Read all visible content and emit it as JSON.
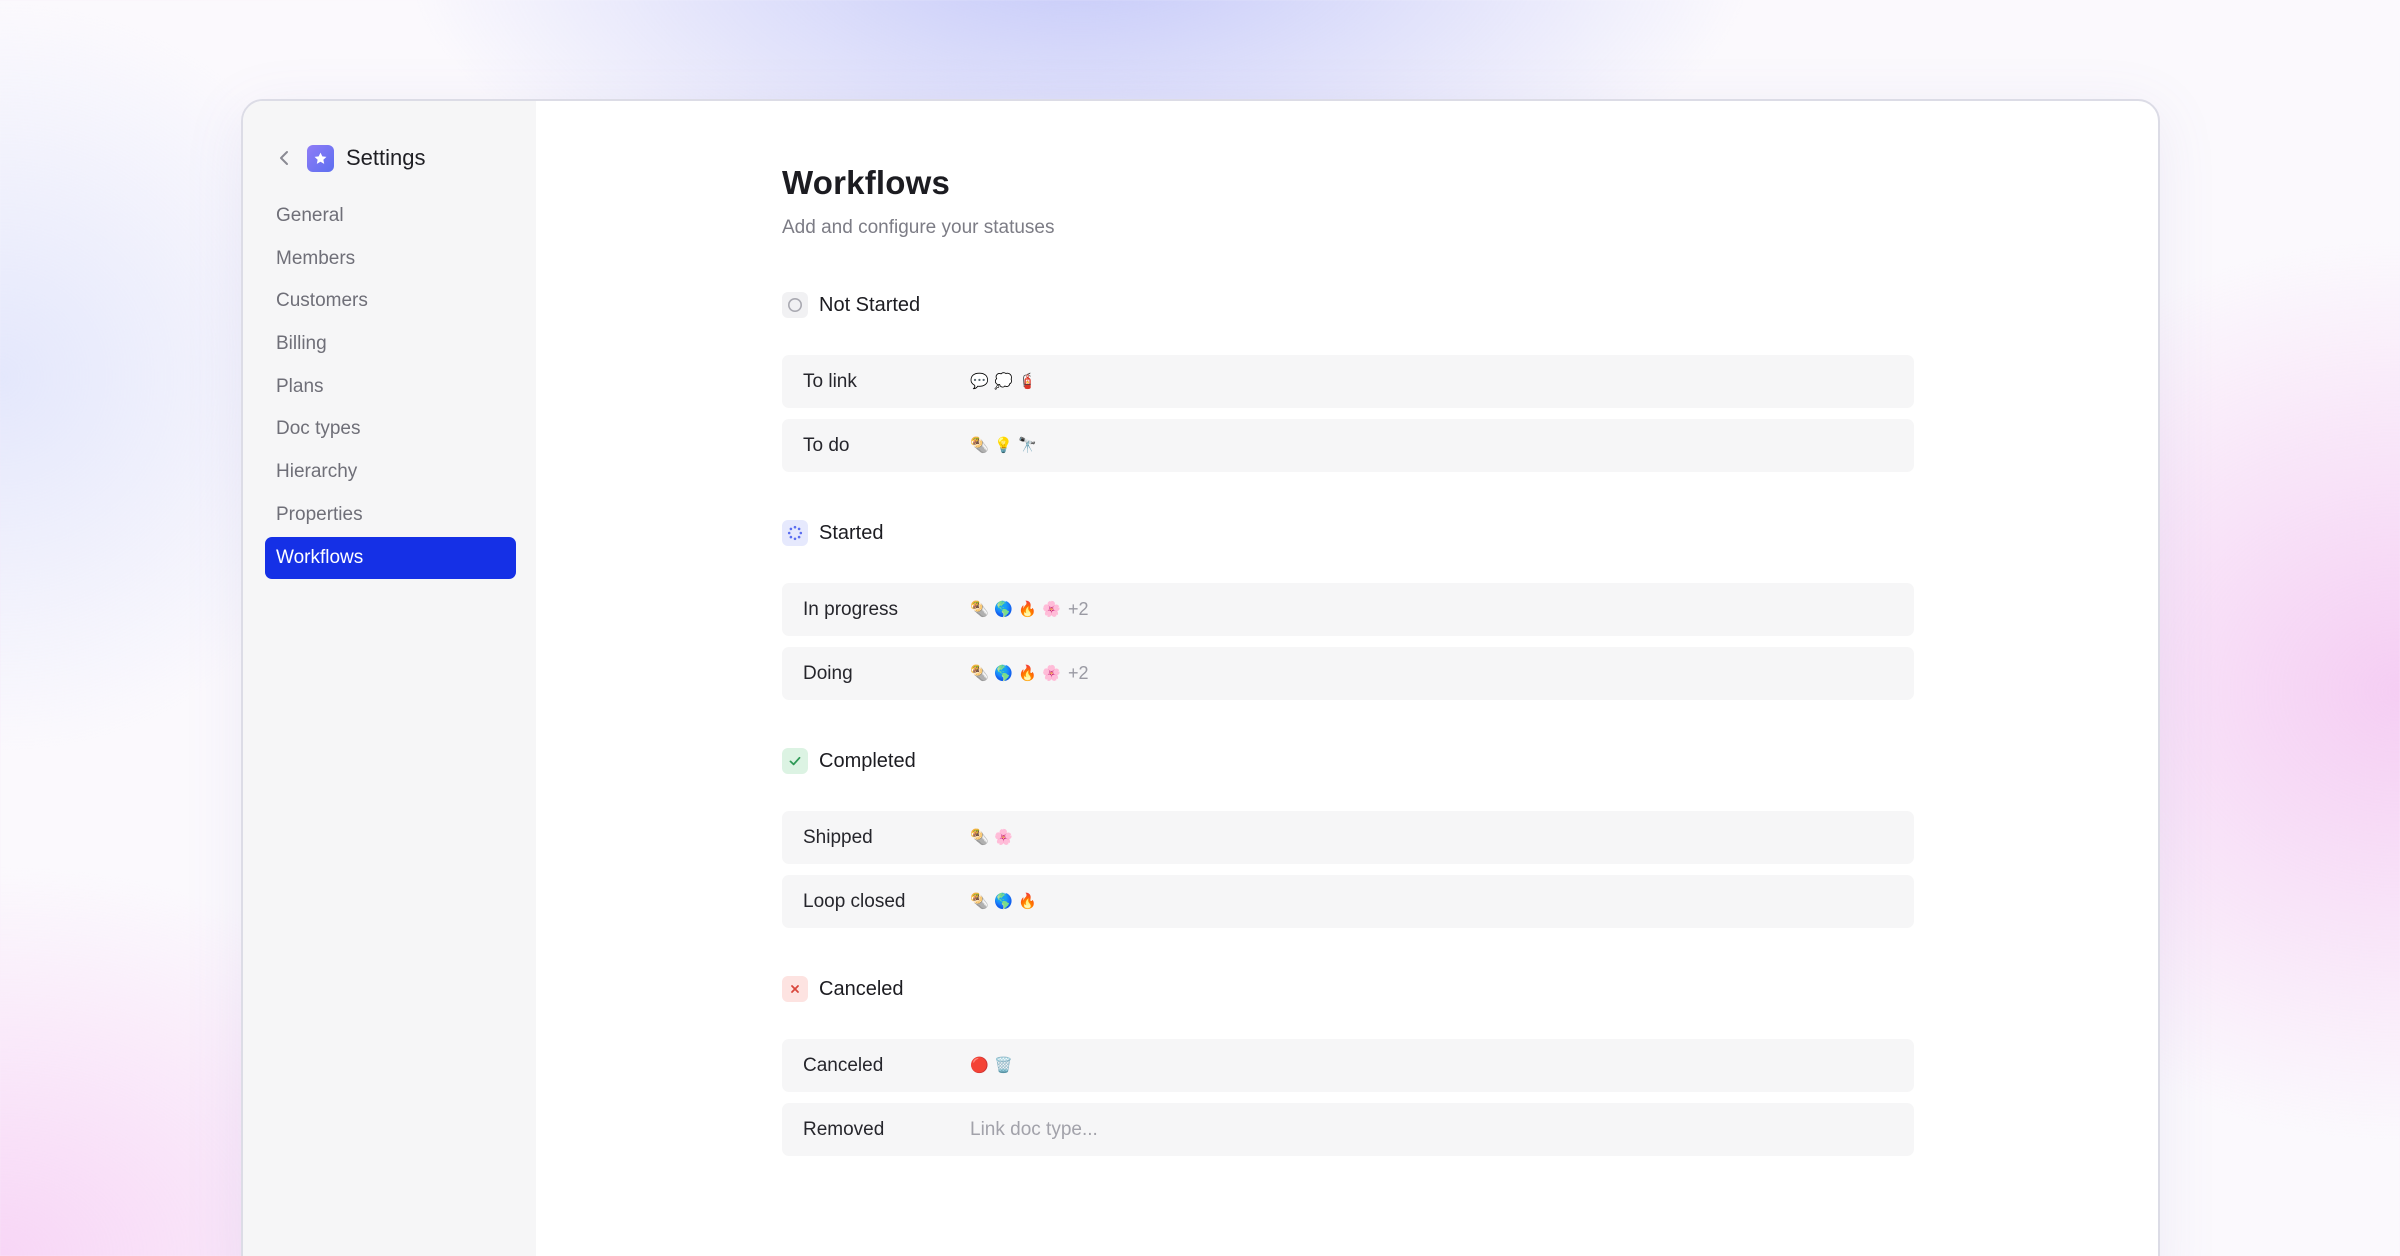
{
  "sidebar": {
    "title": "Settings",
    "back_icon": "chevron-left-icon",
    "logo_icon": "star-icon",
    "items": [
      {
        "label": "General",
        "active": false
      },
      {
        "label": "Members",
        "active": false
      },
      {
        "label": "Customers",
        "active": false
      },
      {
        "label": "Billing",
        "active": false
      },
      {
        "label": "Plans",
        "active": false
      },
      {
        "label": "Doc types",
        "active": false
      },
      {
        "label": "Hierarchy",
        "active": false
      },
      {
        "label": "Properties",
        "active": false
      },
      {
        "label": "Workflows",
        "active": true
      }
    ]
  },
  "main": {
    "title": "Workflows",
    "subtitle": "Add and configure your statuses",
    "groups": [
      {
        "label": "Not Started",
        "icon": "empty-circle-icon",
        "rows": [
          {
            "name": "To link",
            "emojis": [
              "💬",
              "💭",
              "🧯"
            ],
            "more": ""
          },
          {
            "name": "To do",
            "emojis": [
              "🌯",
              "💡",
              "🔭"
            ],
            "more": ""
          }
        ]
      },
      {
        "label": "Started",
        "icon": "progress-spinner-icon",
        "rows": [
          {
            "name": "In progress",
            "emojis": [
              "🌯",
              "🌎",
              "🔥",
              "🌸"
            ],
            "more": "+2"
          },
          {
            "name": "Doing",
            "emojis": [
              "🌯",
              "🌎",
              "🔥",
              "🌸"
            ],
            "more": "+2"
          }
        ]
      },
      {
        "label": "Completed",
        "icon": "checkmark-icon",
        "rows": [
          {
            "name": "Shipped",
            "emojis": [
              "🌯",
              "🌸"
            ],
            "more": ""
          },
          {
            "name": "Loop closed",
            "emojis": [
              "🌯",
              "🌎",
              "🔥"
            ],
            "more": ""
          }
        ]
      },
      {
        "label": "Canceled",
        "icon": "x-mark-icon",
        "rows": [
          {
            "name": "Canceled",
            "emojis": [
              "🔴",
              "🗑️"
            ],
            "more": ""
          },
          {
            "name": "Removed",
            "emojis": [],
            "more": "",
            "placeholder": "Link doc type..."
          }
        ]
      }
    ]
  },
  "colors": {
    "accent": "#1530e6",
    "sidebar_bg": "#f6f6f7",
    "row_bg": "#f6f6f7",
    "logo_gradient_start": "#8f7cf6",
    "logo_gradient_end": "#5c6ff0",
    "not_started_bg": "#f1f1f3",
    "started_bg": "#e6e9fd",
    "completed_bg": "#dcf3e3",
    "canceled_bg": "#fde3e1"
  }
}
